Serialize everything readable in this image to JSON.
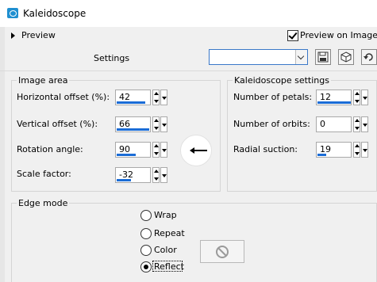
{
  "window": {
    "title": "Kaleidoscope"
  },
  "header": {
    "preview_label": "Preview",
    "preview_on_image_label": "Preview on Image",
    "preview_on_image_checked": true,
    "settings_label": "Settings",
    "settings_value": ""
  },
  "image_area": {
    "title": "Image area",
    "fields": [
      {
        "label": "Horizontal offset (%):",
        "value": "42",
        "level": 0.82
      },
      {
        "label": "Vertical offset (%):",
        "value": "66",
        "level": 0.94
      },
      {
        "label": "Rotation angle:",
        "value": "90",
        "level": 0.55
      },
      {
        "label": "Scale factor:",
        "value": "-32",
        "level": 0.42
      }
    ]
  },
  "kaleido": {
    "title": "Kaleidoscope settings",
    "fields": [
      {
        "label": "Number of petals:",
        "value": "12",
        "level": 0.96
      },
      {
        "label": "Number of orbits:",
        "value": "0",
        "level": 0.0
      },
      {
        "label": "Radial suction:",
        "value": "19",
        "level": 0.25
      }
    ]
  },
  "edge": {
    "title": "Edge mode",
    "options": [
      {
        "label": "Wrap",
        "selected": false
      },
      {
        "label": "Repeat",
        "selected": false
      },
      {
        "label": "Color",
        "selected": false
      },
      {
        "label": "Reflect",
        "selected": true
      }
    ]
  },
  "icons": {
    "app": "kaleidoscope-app-icon",
    "save": "floppy-disk-icon",
    "preset": "cube-icon",
    "reset": "reset-arrow-icon",
    "color_disabled": "no-sign-icon"
  },
  "colors": {
    "accent": "#1a6cd6",
    "background": "#f0f0f0"
  }
}
